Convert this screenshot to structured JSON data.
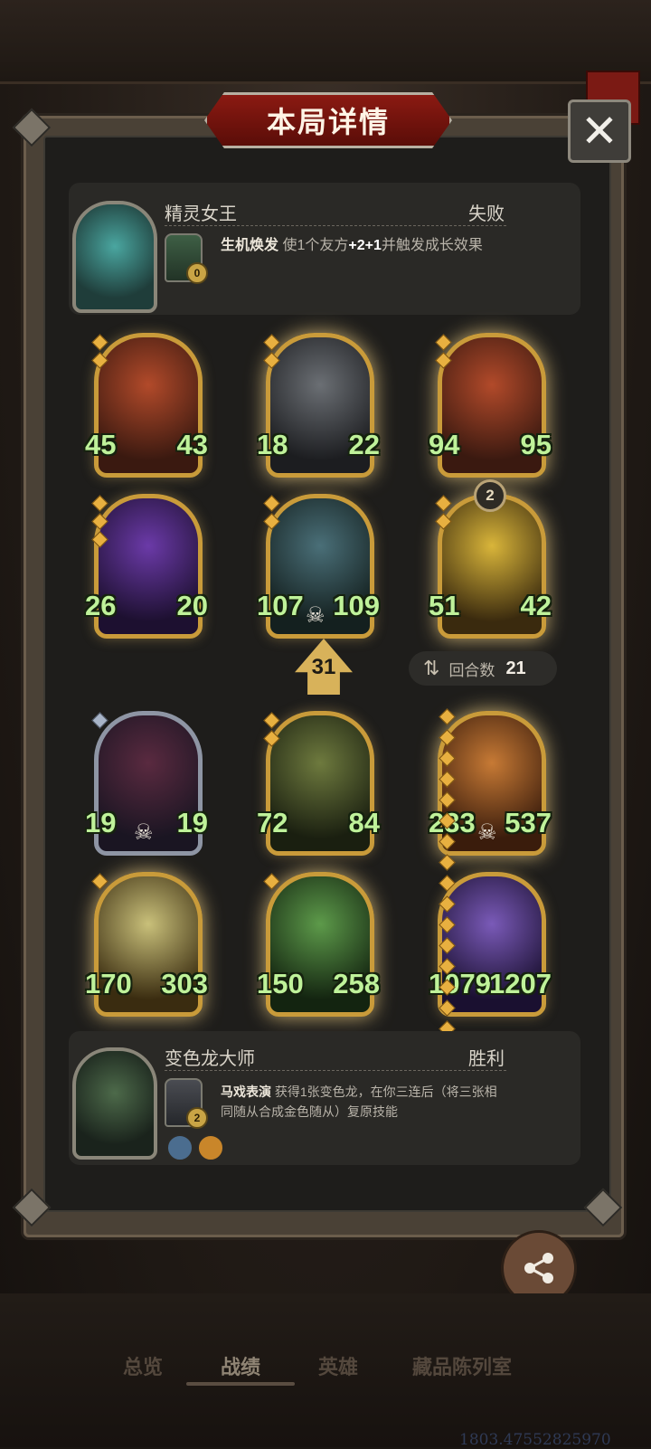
{
  "header": {
    "title": "本局详情",
    "close_label": "✕"
  },
  "top_player": {
    "hero_name": "精灵女王",
    "result": "失败",
    "skill_cost": "0",
    "skill_name": "生机焕发",
    "skill_desc_prefix": "使1个友方",
    "skill_desc_highlight": "+2+1",
    "skill_desc_suffix": "并触发成长效果"
  },
  "top_board": [
    {
      "atk": "45",
      "hp": "43",
      "tier": "gold"
    },
    {
      "atk": "18",
      "hp": "22",
      "tier": "golden"
    },
    {
      "atk": "94",
      "hp": "95",
      "tier": "golden"
    },
    {
      "atk": "26",
      "hp": "20",
      "tier": "gold"
    },
    {
      "atk": "107",
      "hp": "109",
      "tier": "gold"
    },
    {
      "atk": "51",
      "hp": "42",
      "tier": "golden",
      "level": "2"
    }
  ],
  "damage": "31",
  "rounds": {
    "label": "回合数",
    "value": "21"
  },
  "bottom_board": [
    {
      "atk": "19",
      "hp": "19",
      "tier": "silver"
    },
    {
      "atk": "72",
      "hp": "84",
      "tier": "gold"
    },
    {
      "atk": "233",
      "hp": "537",
      "tier": "golden"
    },
    {
      "atk": "170",
      "hp": "303",
      "tier": "golden"
    },
    {
      "atk": "150",
      "hp": "258",
      "tier": "golden"
    },
    {
      "atk": "1079",
      "hp": "1207",
      "tier": "gold"
    }
  ],
  "bottom_player": {
    "hero_name": "变色龙大师",
    "result": "胜利",
    "skill_cost": "2",
    "skill_name": "马戏表演",
    "skill_desc": "获得1张变色龙，在你三连后（将三张相同随从合成金色随从）复原技能"
  },
  "share_label": "分享",
  "tabs": [
    "总览",
    "战绩",
    "英雄",
    "藏品陈列室"
  ],
  "coord_text": "1803.47552825970",
  "colors": {
    "stat_green": "#bff29a",
    "gold_frame": "#c99b3a",
    "banner_red": "#8b1a12"
  }
}
